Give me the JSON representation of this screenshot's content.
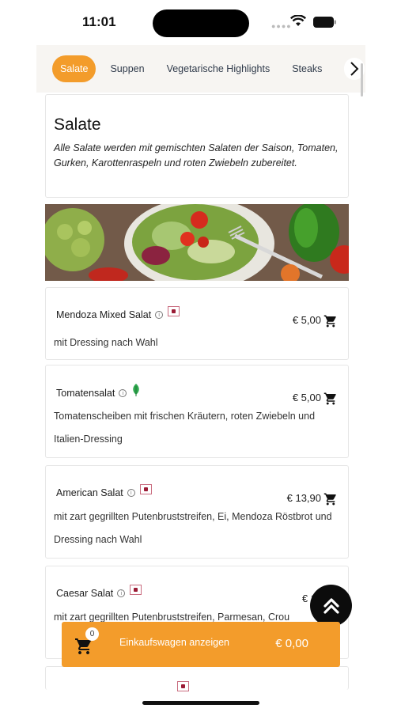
{
  "status": {
    "time": "11:01"
  },
  "tabs": [
    {
      "label": "Salate",
      "active": true
    },
    {
      "label": "Suppen",
      "active": false
    },
    {
      "label": "Vegetarische Highlights",
      "active": false
    },
    {
      "label": "Steaks",
      "active": false
    }
  ],
  "section": {
    "title": "Salate",
    "description": "Alle Salate werden mit gemischten Salaten der Saison, Tomaten, Gurken, Karottenraspeln und roten Zwiebeln zubereitet."
  },
  "items": [
    {
      "name": "Mendoza Mixed Salat",
      "price": "€ 5,00",
      "description": "mit Dressing nach Wahl",
      "badge": "flag-icon"
    },
    {
      "name": "Tomatensalat",
      "price": "€ 5,00",
      "description": "Tomatenscheiben mit frischen Kräutern, roten Zwiebeln und Italien-Dressing",
      "badge": "leaf-icon"
    },
    {
      "name": "American Salat",
      "price": "€ 13,90",
      "description": "mit zart gegrillten Putenbruststreifen, Ei, Mendoza Röstbrot und Dressing nach Wahl",
      "badge": "flag-icon"
    },
    {
      "name": "Caesar Salat",
      "price": "€ 14,9",
      "description": "mit zart gegrillten Putenbruststreifen, Parmesan, Crou",
      "badge": "flag-icon"
    }
  ],
  "cart": {
    "count": "0",
    "label": "Einkaufswagen anzeigen",
    "total": "€ 0,00"
  },
  "colors": {
    "accent": "#f39c2b",
    "fab": "#0c0c0c"
  }
}
